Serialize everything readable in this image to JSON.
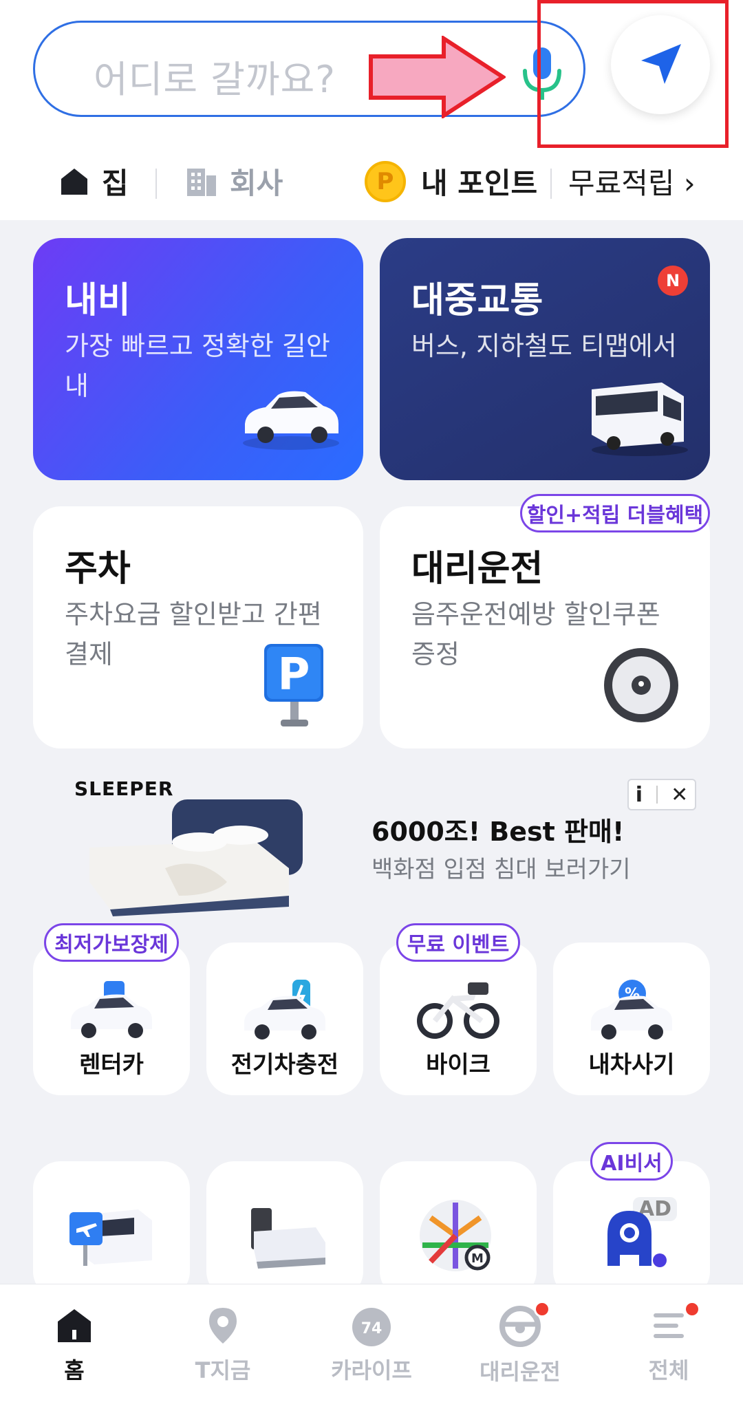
{
  "search": {
    "placeholder": "어디로 갈까요?"
  },
  "shortcuts": {
    "home": "집",
    "work": "회사",
    "points_coin": "P",
    "points": "내 포인트",
    "free": "무료적립 ›"
  },
  "cards": {
    "navi": {
      "title": "내비",
      "sub": "가장 빠르고 정확한 길안내"
    },
    "transit": {
      "title": "대중교통",
      "sub": "버스, 지하철도 티맵에서",
      "badge": "N"
    },
    "parking": {
      "title": "주차",
      "sub": "주차요금 할인받고 간편결제"
    },
    "driver": {
      "title": "대리운전",
      "sub": "음주운전예방 할인쿠폰 증정",
      "pill": "할인+적립 더블혜택"
    }
  },
  "ad": {
    "brand": "SLEEPER",
    "headline": "6000조! Best 판매!",
    "sub": "백화점 입점 침대 보러가기",
    "info": "i",
    "close": "✕"
  },
  "tiles": [
    {
      "label": "렌터카",
      "pill": "최저가보장제"
    },
    {
      "label": "전기차충전"
    },
    {
      "label": "바이크",
      "pill": "무료 이벤트"
    },
    {
      "label": "내차사기"
    }
  ],
  "tiles_row2": {
    "ai_pill": "AI비서",
    "ad_tag": "AD"
  },
  "nav": [
    {
      "label": "홈"
    },
    {
      "label": "T지금"
    },
    {
      "label": "카라이프"
    },
    {
      "label": "대리운전"
    },
    {
      "label": "전체"
    }
  ],
  "car_life_badge": "74",
  "colors": {
    "accent": "#2f6fe4",
    "navi_gradient_start": "#6d3cf5",
    "transit_bg": "#23306b",
    "pill_purple": "#7b45e8",
    "annotation_red": "#e8202a",
    "annotation_arrow_fill": "#f7a8c0"
  }
}
